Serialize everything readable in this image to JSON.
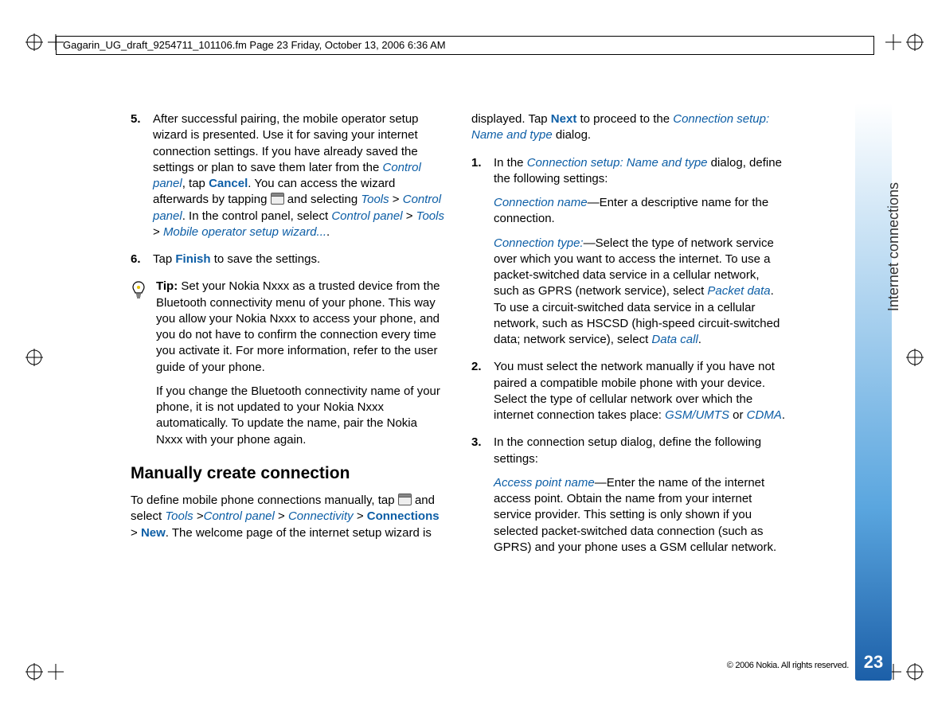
{
  "header": {
    "line": "Gagarin_UG_draft_9254711_101106.fm  Page 23  Friday, October 13, 2006  6:36 AM"
  },
  "left": {
    "step5": {
      "num": "5.",
      "t1": "After successful pairing, the mobile operator setup wizard is presented. Use it for saving your internet connection settings. If you have already saved the settings or plan to save them later from the ",
      "cp1": "Control panel",
      "t2": ", tap ",
      "cancel": "Cancel",
      "t3": ". You can access the wizard afterwards by tapping ",
      "t4": " and selecting ",
      "tools": "Tools",
      "gt1": " > ",
      "cp2": "Control panel",
      "t5": ". In the control panel, select ",
      "cp3": "Control panel",
      "gt2": " > ",
      "tools2": "Tools",
      "gt3": " > ",
      "wizard": "Mobile operator setup wizard...",
      "t6": "."
    },
    "step6": {
      "num": "6.",
      "t1": "Tap ",
      "finish": "Finish",
      "t2": " to save the settings."
    },
    "tip": {
      "label": "Tip:",
      "t1": " Set your Nokia Nxxx as a trusted device from the Bluetooth connectivity menu of your phone. This way you allow your Nokia Nxxx to access your phone, and you do not have to confirm the connection every time you activate it. For more information, refer to the user guide of your phone.",
      "t2": "If you change the Bluetooth connectivity name of your phone, it is not updated to your Nokia Nxxx automatically. To update the name, pair the Nokia Nxxx with your phone again."
    },
    "section": "Manually create connection",
    "para": {
      "t1": "To define mobile phone connections manually, tap ",
      "t2": " and select ",
      "tools": "Tools",
      "gt1": " >",
      "cp": "Control panel",
      "gt2": " > ",
      "conn": "Connectivity",
      "gt3": " > ",
      "connections": "Connections",
      "gt4": " > ",
      "new": "New",
      "t3": ". The welcome page of the internet setup wizard is "
    }
  },
  "right": {
    "intro": {
      "t1": "displayed. Tap ",
      "next": "Next",
      "t2": " to proceed to the ",
      "dlg": "Connection setup: Name and type",
      "t3": " dialog."
    },
    "step1": {
      "num": "1.",
      "t1": "In the ",
      "dlg": "Connection setup: Name and type",
      "t2": " dialog, define the following settings:",
      "cname": "Connection name",
      "cname_t": "—Enter a descriptive name for the connection.",
      "ctype": "Connection type:",
      "ctype_t1": "—Select the type of network service over which you want to access the internet. To use a packet-switched data service in a cellular network, such as GPRS (network service), select ",
      "packet": "Packet data",
      "ctype_t2": ". To use a circuit-switched data service in a cellular network, such as HSCSD (high-speed circuit-switched data; network service), select ",
      "datacall": "Data call",
      "ctype_t3": "."
    },
    "step2": {
      "num": "2.",
      "t1": "You must select the network manually if you have not paired a compatible mobile phone with your device. Select the type of cellular network over which the internet connection takes place: ",
      "gsm": "GSM/UMTS",
      "or": " or ",
      "cdma": "CDMA",
      "t2": "."
    },
    "step3": {
      "num": "3.",
      "t1": "In the connection setup dialog, define the following settings:",
      "apn": "Access point name",
      "apn_t": "—Enter the name of the internet access point. Obtain the name from your internet service provider. This setting is only shown if you selected packet-switched data connection (such as GPRS) and your phone uses a GSM cellular network."
    }
  },
  "sidebar": {
    "label": "Internet connections",
    "page": "23"
  },
  "footer": {
    "copyright": "© 2006 Nokia. All rights reserved."
  }
}
